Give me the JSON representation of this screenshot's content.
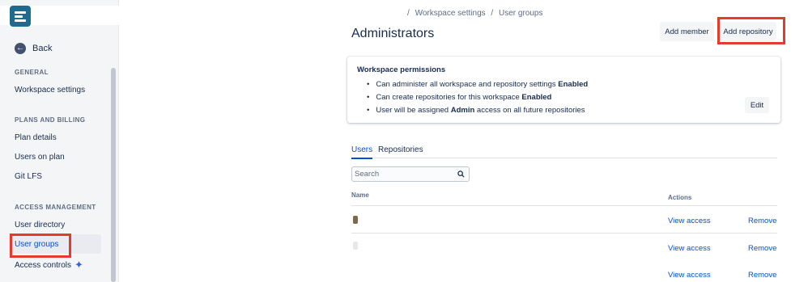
{
  "sidebar": {
    "back_label": "Back",
    "sections": [
      {
        "heading": "GENERAL",
        "items": [
          {
            "label": "Workspace settings"
          }
        ]
      },
      {
        "heading": "PLANS AND BILLING",
        "items": [
          {
            "label": "Plan details"
          },
          {
            "label": "Users on plan"
          },
          {
            "label": "Git LFS"
          }
        ]
      },
      {
        "heading": "ACCESS MANAGEMENT",
        "items": [
          {
            "label": "User directory"
          },
          {
            "label": "User groups"
          },
          {
            "label": "Access controls"
          }
        ]
      }
    ],
    "active_item": "User groups"
  },
  "breadcrumb": [
    "/",
    "Workspace settings",
    "/",
    "User groups"
  ],
  "page_title": "Administrators",
  "header_buttons": {
    "add_member": "Add member",
    "add_repository": "Add repository"
  },
  "permissions": {
    "title": "Workspace permissions",
    "items": [
      {
        "before": "Can administer all workspace and repository settings ",
        "bold": "Enabled",
        "after": ""
      },
      {
        "before": "Can create repositories for this workspace ",
        "bold": "Enabled",
        "after": ""
      },
      {
        "before": "User will be assigned ",
        "bold": "Admin",
        "after": " access on all future repositories"
      }
    ],
    "edit_label": "Edit"
  },
  "tabs": [
    {
      "label": "Users",
      "active": true
    },
    {
      "label": "Repositories",
      "active": false
    }
  ],
  "search": {
    "placeholder": "Search",
    "value": ""
  },
  "table": {
    "columns": {
      "name": "Name",
      "actions": "Actions"
    },
    "rows": [
      {
        "view_label": "View access",
        "remove_label": "Remove"
      },
      {
        "view_label": "View access",
        "remove_label": "Remove"
      },
      {
        "view_label": "View access",
        "remove_label": "Remove"
      }
    ]
  },
  "colors": {
    "accent": "#0052cc",
    "highlight_box": "#e53b2c",
    "logo": "#1e6b8f",
    "sparkle": "#2f64e3"
  }
}
